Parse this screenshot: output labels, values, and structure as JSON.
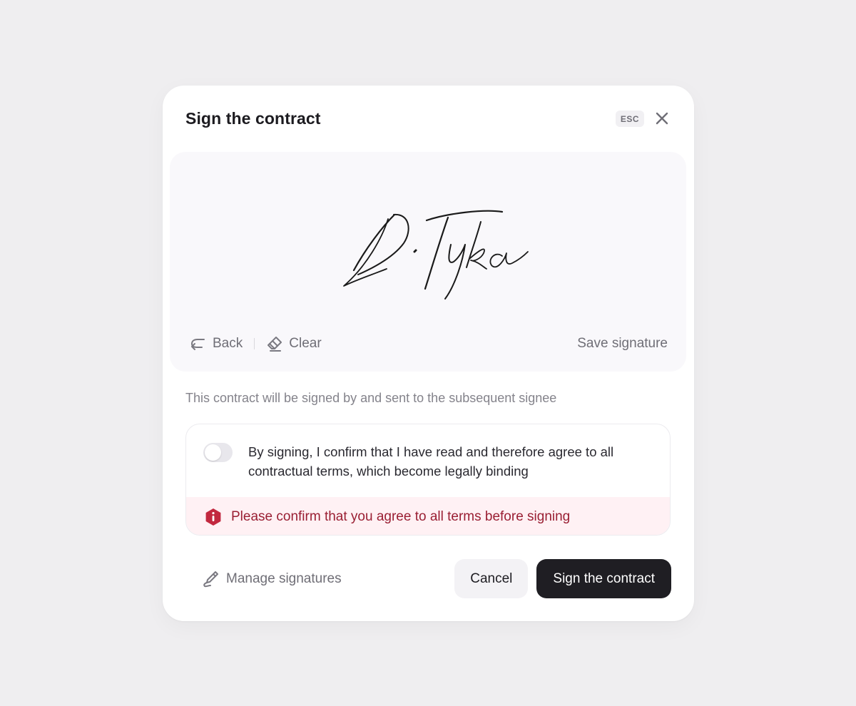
{
  "dialog": {
    "title": "Sign the contract",
    "esc_label": "ESC",
    "close_icon": "close-icon"
  },
  "signature_pad": {
    "signature_image": "handwritten signature",
    "back_label": "Back",
    "back_icon": "undo-arrow-icon",
    "clear_label": "Clear",
    "clear_icon": "eraser-icon",
    "save_label": "Save signature"
  },
  "info_text": "This contract will be signed by and sent to the subsequent signee",
  "confirmation": {
    "toggle_on": false,
    "text": "By signing, I confirm that I have read and therefore agree to all contractual terms, which become legally binding",
    "error_icon": "error-hexagon-icon",
    "error_text": "Please confirm that you agree to all terms before signing",
    "error_color": "#9a1f33"
  },
  "footer": {
    "manage_label": "Manage signatures",
    "manage_icon": "pen-icon",
    "cancel_label": "Cancel",
    "sign_label": "Sign the contract"
  },
  "colors": {
    "background": "#efeef0",
    "primary_button": "#1f1e23",
    "error_background": "#fff1f4"
  }
}
